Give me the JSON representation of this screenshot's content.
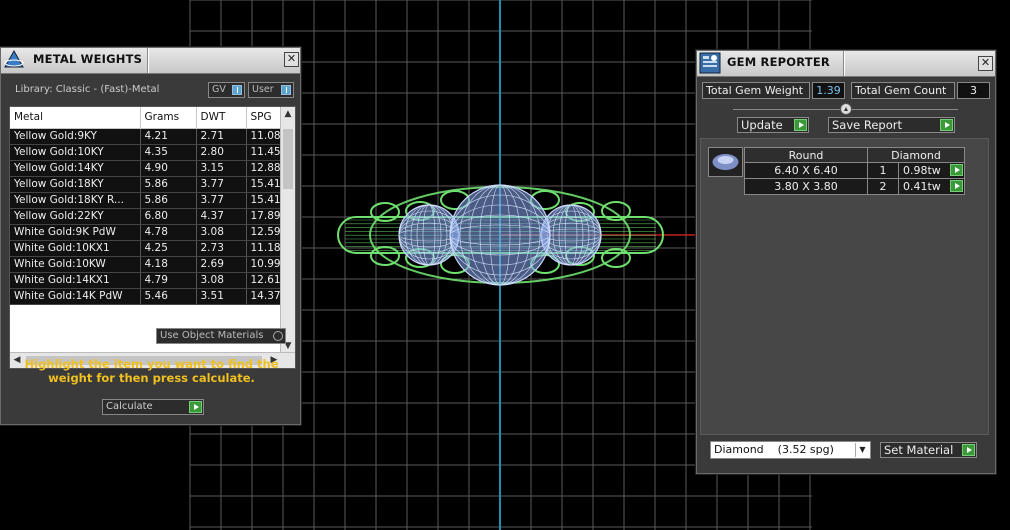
{
  "metal_weights": {
    "title": "METAL WEIGHTS",
    "library_label": "Library: Classic - (Fast)-Metal",
    "toggle_gv": "GV",
    "toggle_user": "User",
    "columns": [
      "Metal",
      "Grams",
      "DWT",
      "SPG"
    ],
    "rows": [
      [
        "Yellow Gold:9KY",
        "4.21",
        "2.71",
        "11.08"
      ],
      [
        "Yellow Gold:10KY",
        "4.35",
        "2.80",
        "11.45"
      ],
      [
        "Yellow Gold:14KY",
        "4.90",
        "3.15",
        "12.88"
      ],
      [
        "Yellow Gold:18KY",
        "5.86",
        "3.77",
        "15.41"
      ],
      [
        "Yellow Gold:18KY R...",
        "5.86",
        "3.77",
        "15.41"
      ],
      [
        "Yellow Gold:22KY",
        "6.80",
        "4.37",
        "17.89"
      ],
      [
        "White Gold:9K PdW",
        "4.78",
        "3.08",
        "12.59"
      ],
      [
        "White Gold:10KX1",
        "4.25",
        "2.73",
        "11.18"
      ],
      [
        "White Gold:10KW",
        "4.18",
        "2.69",
        "10.99"
      ],
      [
        "White Gold:14KX1",
        "4.79",
        "3.08",
        "12.61"
      ],
      [
        "White Gold:14K PdW",
        "5.46",
        "3.51",
        "14.37"
      ]
    ],
    "use_object_materials": "Use Object Materials",
    "hint": "Highlight the item you want to find the weight for then press calculate.",
    "calculate_label": "Calculate",
    "close_icon": "close-icon"
  },
  "gem_reporter": {
    "title": "GEM REPORTER",
    "total_weight_label": "Total Gem Weight",
    "total_weight_value": "1.39",
    "total_count_label": "Total Gem Count",
    "total_count_value": "3",
    "update_label": "Update",
    "save_report_label": "Save Report",
    "table_headers": [
      "Round",
      "Diamond"
    ],
    "gems": [
      {
        "size": "6.40 X 6.40",
        "count": "1",
        "weight": "0.98tw"
      },
      {
        "size": "3.80 X 3.80",
        "count": "2",
        "weight": "0.41tw"
      }
    ],
    "material_select": "Diamond    (3.52 spg)",
    "set_material_label": "Set Material",
    "accent_colors": {
      "play_green": "#3a9a3a",
      "value_blue": "#7ac0ee",
      "hint_yellow": "#f0c020"
    }
  },
  "viewport": {
    "grid_color": "#5a5a5a",
    "axis_vertical_color": "#1e8fb0",
    "axis_horizontal_color": "#c02020",
    "band_color": "#6fe06f",
    "gem_color": "#86a8f0"
  }
}
